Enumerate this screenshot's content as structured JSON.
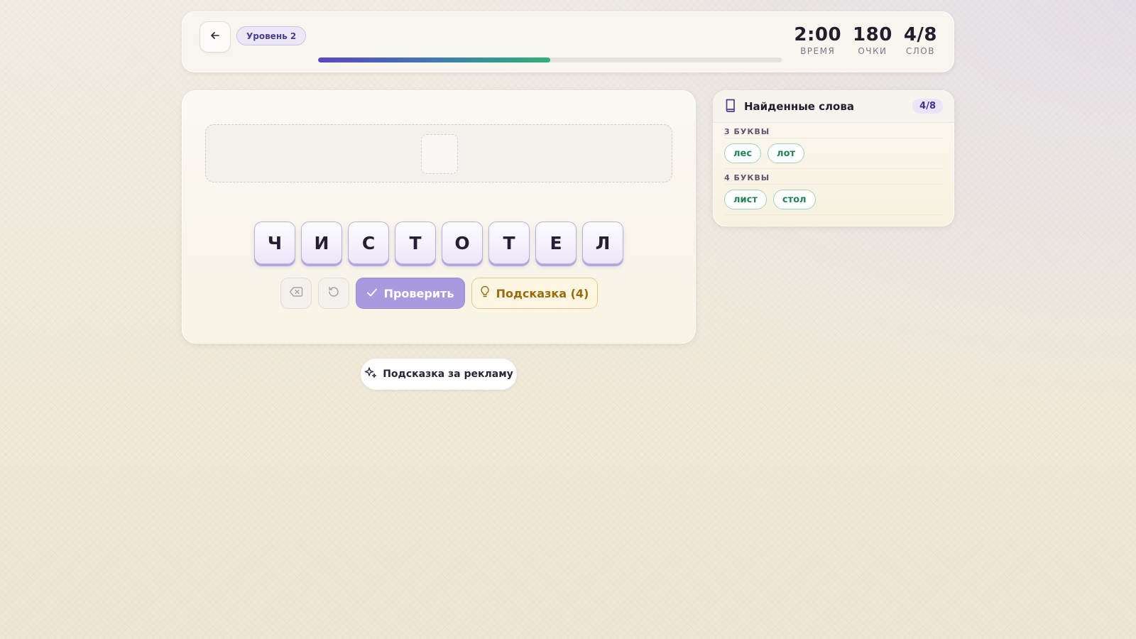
{
  "header": {
    "level": "Уровень 2",
    "progress": 0.5,
    "stats": [
      {
        "value": "2:00",
        "label": "ВРЕМЯ"
      },
      {
        "value": "180",
        "label": "ОЧКИ"
      },
      {
        "value": "4/8",
        "label": "СЛОВ"
      }
    ]
  },
  "game": {
    "letters": [
      "Ч",
      "И",
      "С",
      "Т",
      "О",
      "Т",
      "Е",
      "Л"
    ],
    "check_label": "Проверить",
    "hint_label": "Подсказка (4)"
  },
  "ad_hint_label": "Подсказка за рекламу",
  "found": {
    "title": "Найденные слова",
    "count": "4/8",
    "groups": [
      {
        "label": "3 БУКВЫ",
        "words": [
          "лес",
          "лот"
        ]
      },
      {
        "label": "4 БУКВЫ",
        "words": [
          "лист",
          "стол"
        ]
      }
    ]
  },
  "colors": {
    "accent": "#a99ae0",
    "hint": "#9a6a0c",
    "found_word": "#218257"
  }
}
